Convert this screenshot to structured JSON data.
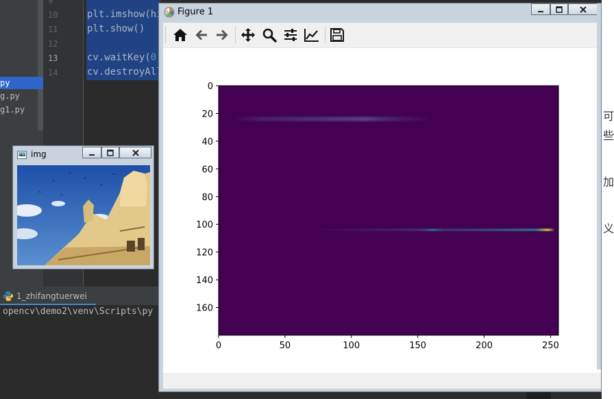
{
  "ide": {
    "files": [
      {
        "name": "py",
        "selected": true
      },
      {
        "name": "g.py",
        "selected": false
      },
      {
        "name": "g1.py",
        "selected": false
      }
    ],
    "line_numbers": [
      "9",
      "10",
      "11",
      "12",
      "13",
      "14"
    ],
    "active_line": "13",
    "code_lines": [
      {
        "text": "plt.imshow(hi"
      },
      {
        "text": "plt.show()"
      },
      {
        "text": ""
      },
      {
        "pre": "cv.waitKey(",
        "num": "0",
        "post": ")"
      },
      {
        "text": "cv.destroyAll"
      }
    ],
    "run_tab_label": "1_zhifangtuerwei",
    "run_output": "opencv\\demo2\\venv\\Scripts\\py",
    "right_edge_chars": [
      "可",
      "些",
      "加",
      "义"
    ]
  },
  "img_window": {
    "title": "img",
    "icon": "app-image-icon",
    "controls": [
      "minimize-icon",
      "maximize-icon",
      "close-icon"
    ]
  },
  "figure_window": {
    "title": "Figure 1",
    "icon": "matplotlib-logo-icon",
    "controls": [
      "minimize-icon",
      "maximize-icon",
      "close-icon"
    ],
    "toolbar": [
      {
        "name": "home-button",
        "icon": "home-icon"
      },
      {
        "name": "back-button",
        "icon": "arrow-left-icon"
      },
      {
        "name": "forward-button",
        "icon": "arrow-right-icon"
      },
      {
        "name": "pan-button",
        "icon": "move-icon"
      },
      {
        "name": "zoom-button",
        "icon": "magnifier-icon"
      },
      {
        "name": "subplots-button",
        "icon": "sliders-icon"
      },
      {
        "name": "axes-edit-button",
        "icon": "line-chart-icon"
      },
      {
        "name": "save-button",
        "icon": "floppy-disk-icon"
      }
    ]
  },
  "chart_data": {
    "type": "heatmap",
    "title": "",
    "xlabel": "",
    "ylabel": "",
    "x_ticks": [
      0,
      50,
      100,
      150,
      200,
      250
    ],
    "y_ticks": [
      0,
      20,
      40,
      60,
      80,
      100,
      120,
      140,
      160
    ],
    "xlim": [
      0,
      256
    ],
    "ylim": [
      180,
      0
    ],
    "colormap": "viridis",
    "background_color": "#440154",
    "grid": false,
    "bands": [
      {
        "y": 24,
        "x_start": 10,
        "x_end": 160,
        "peak_x": 110,
        "intensity": 0.12
      },
      {
        "y": 104,
        "x_start": 70,
        "x_end": 252,
        "peak_x": 248,
        "intensity": 0.9
      }
    ]
  }
}
